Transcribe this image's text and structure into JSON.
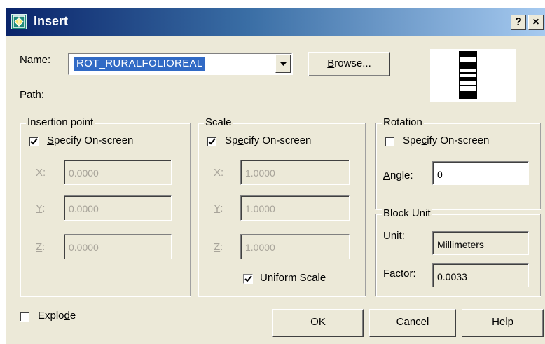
{
  "title": "Insert",
  "titlebar_buttons": {
    "help": "?",
    "close": "×"
  },
  "name": {
    "label": "Name:",
    "value": "ROT_RURALFOLIOREAL"
  },
  "browse_label": "Browse...",
  "path_label": "Path:",
  "insertion_point": {
    "title": "Insertion point",
    "specify_label": "Specify On-screen",
    "specify_checked": true,
    "x": {
      "label": "X:",
      "value": "0.0000"
    },
    "y": {
      "label": "Y:",
      "value": "0.0000"
    },
    "z": {
      "label": "Z:",
      "value": "0.0000"
    }
  },
  "scale": {
    "title": "Scale",
    "specify_label": "Specify On-screen",
    "specify_checked": true,
    "x": {
      "label": "X:",
      "value": "1.0000"
    },
    "y": {
      "label": "Y:",
      "value": "1.0000"
    },
    "z": {
      "label": "Z:",
      "value": "1.0000"
    },
    "uniform_label": "Uniform Scale",
    "uniform_checked": true
  },
  "rotation": {
    "title": "Rotation",
    "specify_label": "Specify On-screen",
    "specify_checked": false,
    "angle_label": "Angle:",
    "angle_value": "0"
  },
  "block_unit": {
    "title": "Block Unit",
    "unit_label": "Unit:",
    "unit_value": "Millimeters",
    "factor_label": "Factor:",
    "factor_value": "0.0033"
  },
  "explode": {
    "label": "Explode",
    "checked": false
  },
  "buttons": {
    "ok": "OK",
    "cancel": "Cancel",
    "help": "Help"
  },
  "icons": {
    "title": "insert-block-icon",
    "dropdown": "chevron-down-icon",
    "check": "checkmark-icon",
    "preview": "block-preview-icon"
  }
}
